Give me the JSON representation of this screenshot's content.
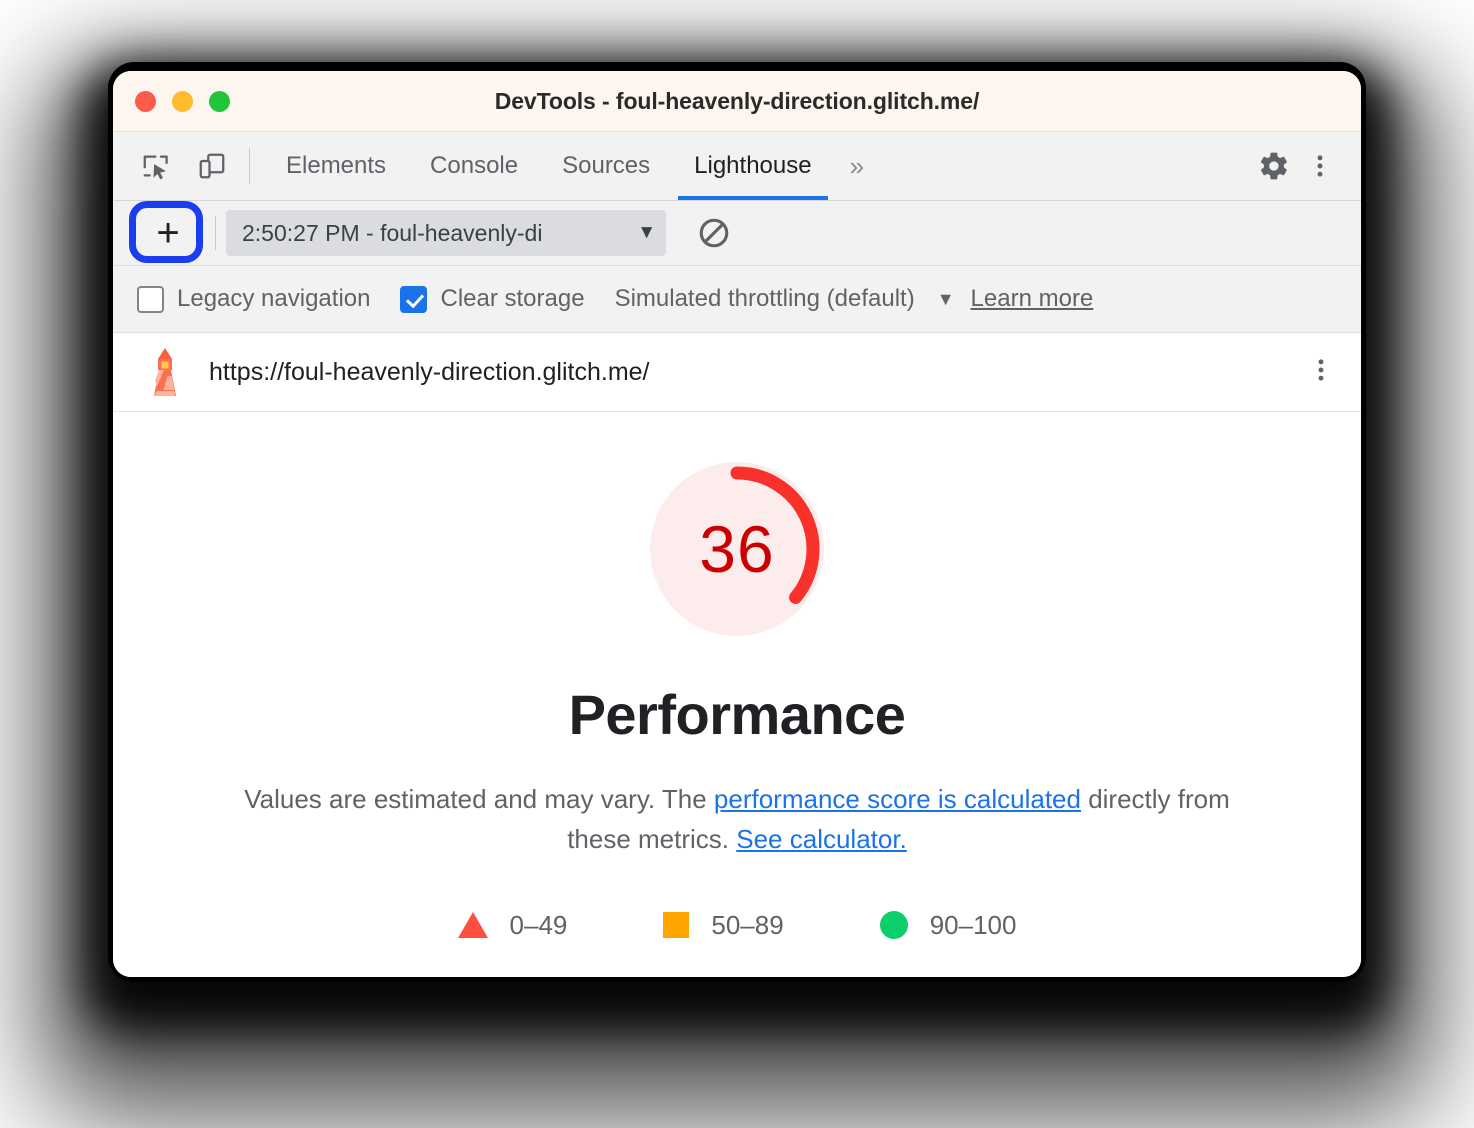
{
  "window": {
    "title": "DevTools - foul-heavenly-direction.glitch.me/",
    "traffic_lights": [
      "close",
      "minimize",
      "maximize"
    ]
  },
  "devtools_toolbar": {
    "inspect_icon": "inspect-element-icon",
    "device_toggle_icon": "device-toolbar-icon",
    "tabs": [
      {
        "label": "Elements",
        "active": false
      },
      {
        "label": "Console",
        "active": false
      },
      {
        "label": "Sources",
        "active": false
      },
      {
        "label": "Lighthouse",
        "active": true
      }
    ],
    "more_tabs_glyph": "»",
    "settings_icon": "gear-icon",
    "main_menu_icon": "kebab-menu-icon"
  },
  "lighthouse_toolbar": {
    "add_button_label": "+",
    "add_button_highlighted": true,
    "run_select_value": "2:50:27 PM - foul-heavenly-di",
    "run_select_caret": "▼",
    "clear_icon": "clear-all-icon"
  },
  "options": {
    "legacy_navigation": {
      "label": "Legacy navigation",
      "checked": false
    },
    "clear_storage": {
      "label": "Clear storage",
      "checked": true
    },
    "throttling": {
      "label": "Simulated throttling (default)",
      "caret": "▼"
    },
    "learn_more": "Learn more"
  },
  "url_row": {
    "icon": "lighthouse-icon",
    "url": "https://foul-heavenly-direction.glitch.me/",
    "kebab_icon": "kebab-menu-icon"
  },
  "report": {
    "title": "Performance",
    "description_before": "Values are estimated and may vary. The ",
    "link_1": "performance score is calculated",
    "description_middle": " directly from these metrics. ",
    "link_2": "See calculator.",
    "legend": [
      {
        "shape": "triangle",
        "label": "0–49",
        "color": "#ff4e42"
      },
      {
        "shape": "square",
        "label": "50–89",
        "color": "#ffa400"
      },
      {
        "shape": "circle",
        "label": "90–100",
        "color": "#0cce6b"
      }
    ]
  },
  "chart_data": {
    "type": "gauge",
    "title": "Performance",
    "value": 36,
    "min": 0,
    "max": 100,
    "unit": "score",
    "arc_start_deg": 0,
    "arc_sweep_deg": 129.6,
    "track_color": "#fdecec",
    "arc_color": "#f8312a",
    "score_text_color": "#cc0000",
    "thresholds": [
      {
        "label": "0–49",
        "range": [
          0,
          49
        ],
        "color": "#ff4e42"
      },
      {
        "label": "50–89",
        "range": [
          50,
          89
        ],
        "color": "#ffa400"
      },
      {
        "label": "90–100",
        "range": [
          90,
          100
        ],
        "color": "#0cce6b"
      }
    ]
  }
}
